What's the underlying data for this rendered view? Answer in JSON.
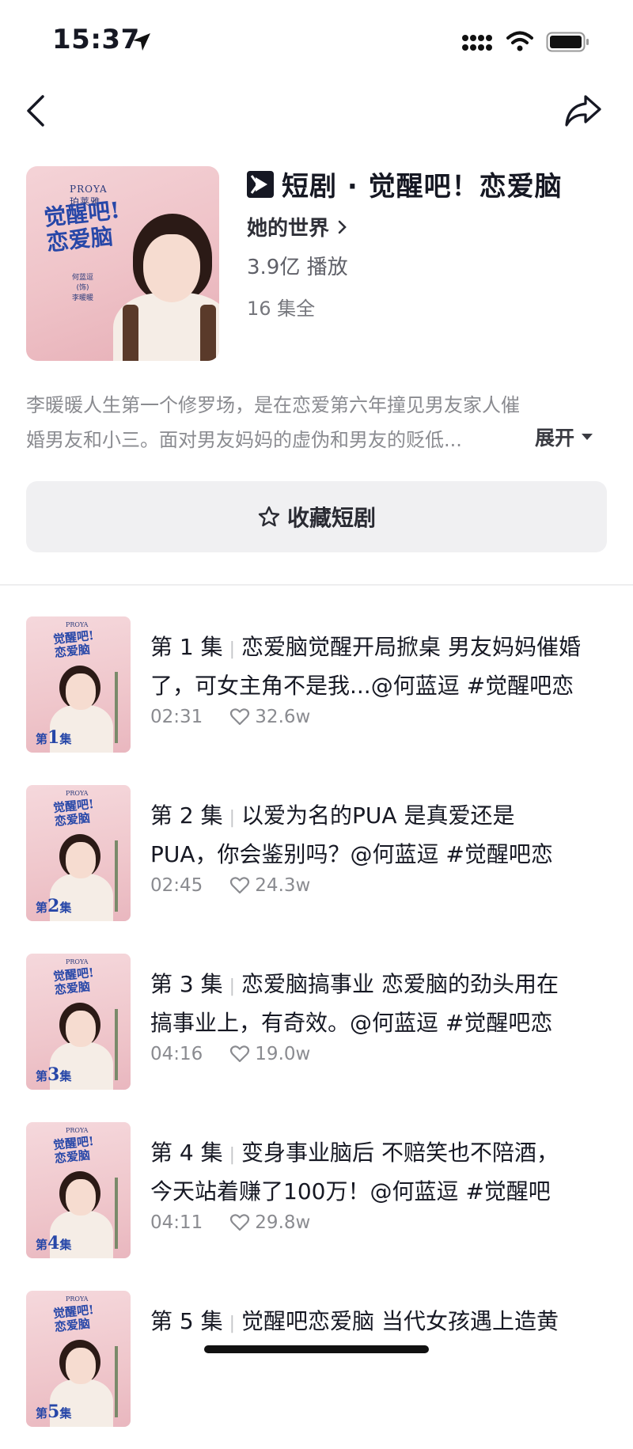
{
  "status_bar": {
    "time": "15:37"
  },
  "header": {
    "cover": {
      "brand": "PROYA",
      "brand_sub": "珀莱雅",
      "title": "觉醒吧!恋爱脑",
      "cast_1": "何蓝逗",
      "cast_role": "(饰)",
      "cast_2": "李暖暖"
    },
    "title": "短剧 · 觉醒吧！恋爱脑",
    "author": "她的世界",
    "plays": "3.9亿 播放",
    "episodes": "16 集全"
  },
  "description": {
    "line1": "李暖暖人生第一个修罗场，是在恋爱第六年撞见男友家人催",
    "line2": "婚男友和小三。面对男友妈妈的虚伪和男友的贬低...",
    "expand_label": "展开"
  },
  "favorite_button": {
    "label": "收藏短剧"
  },
  "episodes": [
    {
      "num": "第 1 集",
      "line1": "恋爱脑觉醒开局掀桌 男友妈妈催婚",
      "line2": "了，可女主角不是我...@何蓝逗 #觉醒吧恋",
      "duration": "02:31",
      "likes": "32.6w",
      "badge_num": "1"
    },
    {
      "num": "第 2 集",
      "line1": "以爱为名的PUA 是真爱还是",
      "line2": "PUA，你会鉴别吗？@何蓝逗 #觉醒吧恋",
      "duration": "02:45",
      "likes": "24.3w",
      "badge_num": "2"
    },
    {
      "num": "第 3 集",
      "line1": "恋爱脑搞事业 恋爱脑的劲头用在",
      "line2": "搞事业上，有奇效。@何蓝逗 #觉醒吧恋",
      "duration": "04:16",
      "likes": "19.0w",
      "badge_num": "3"
    },
    {
      "num": "第 4 集",
      "line1": "变身事业脑后 不赔笑也不陪酒，",
      "line2": "今天站着赚了100万！@何蓝逗 #觉醒吧",
      "duration": "04:11",
      "likes": "29.8w",
      "badge_num": "4"
    },
    {
      "num": "第 5 集",
      "line1": "觉醒吧恋爱脑 当代女孩遇上造黄",
      "line2": "",
      "duration": "",
      "likes": "",
      "badge_num": "5"
    }
  ],
  "thumb_badge_prefix": "第",
  "thumb_badge_suffix": "集",
  "colors": {
    "accent_title": "#2747a8",
    "cover_bg": "#efc3c8"
  }
}
